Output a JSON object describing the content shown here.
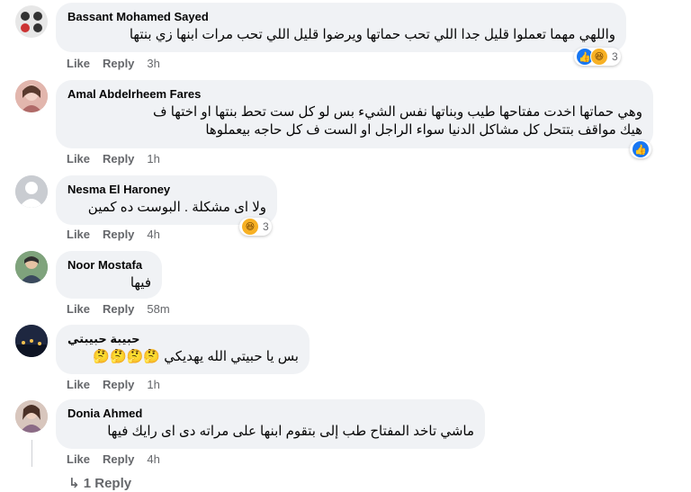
{
  "comments": [
    {
      "author": "Bassant Mohamed Sayed",
      "text": "واللهي مهما تعملوا قليل جدا اللي تحب حماتها ويرضوا قليل اللي تحب مرات ابنها زي بنتها",
      "like_label": "Like",
      "reply_label": "Reply",
      "time": "3h",
      "reaction_count": "3",
      "reactions": [
        "like-icon",
        "haha-icon"
      ]
    },
    {
      "author": "Amal Abdelrheem Fares",
      "text_line1": "وهي حماتها اخدت مفتاحها طيب وبناتها نفس الشيء بس لو كل ست تحط بنتها او اختها ف",
      "text_line2": "هيك مواقف بتتحل كل مشاكل الدنيا سواء الراجل او الست ف كل حاجه بيعملوها",
      "like_label": "Like",
      "reply_label": "Reply",
      "time": "1h",
      "reactions": [
        "like-icon"
      ]
    },
    {
      "author": "Nesma El Haroney",
      "text": "ولا اى مشكلة . البوست ده كمين",
      "like_label": "Like",
      "reply_label": "Reply",
      "time": "4h",
      "reaction_count": "3",
      "reactions": [
        "haha-icon"
      ]
    },
    {
      "author": "Noor Mostafa",
      "text": "فيها",
      "like_label": "Like",
      "reply_label": "Reply",
      "time": "58m"
    },
    {
      "author": "حبيبة حبيبتي",
      "text": "بس يا حبيتي الله يهديكي",
      "emojis": "🤔🤔🤔🤔",
      "like_label": "Like",
      "reply_label": "Reply",
      "time": "1h"
    },
    {
      "author": "Donia Ahmed",
      "text": "ماشي تاخد المفتاح طب إلى بتقوم ابنها على مراته دى اى رايك فيها",
      "like_label": "Like",
      "reply_label": "Reply",
      "time": "4h"
    }
  ],
  "replies_link": {
    "arrow": "↳",
    "label": "1 Reply"
  },
  "colors": {
    "bubble": "#f0f2f5",
    "meta": "#65676b",
    "like_blue": "#1877f2",
    "haha_yellow": "#f7b125"
  }
}
